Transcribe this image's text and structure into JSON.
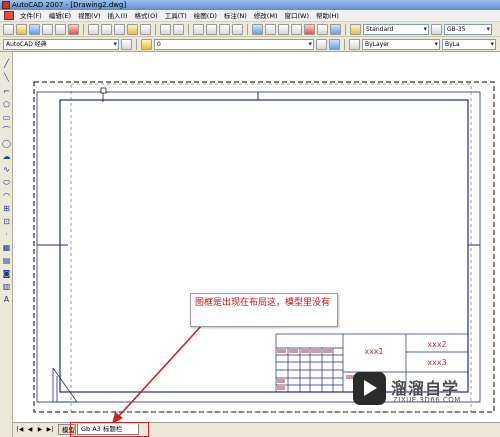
{
  "window": {
    "title": "AutoCAD 2007 - [Drawing2.dwg]"
  },
  "menu": [
    "文件(F)",
    "编辑(E)",
    "视图(V)",
    "插入(I)",
    "格式(O)",
    "工具(T)",
    "绘图(D)",
    "标注(N)",
    "修改(M)",
    "窗口(W)",
    "帮助(H)"
  ],
  "toolbar": {
    "text_style": "Standard",
    "dim_style": "GB-35",
    "workspace": "AutoCAD 经典",
    "layer": "0",
    "color": "ByLayer",
    "linetype": "ByLa"
  },
  "drawing": {
    "title_block": {
      "field_1": "xxx1",
      "field_2": "xxx2",
      "field_3": "xxx3"
    }
  },
  "callout": {
    "text": "图框是出现在布局这，模型里没有"
  },
  "tabs": {
    "model": "模型",
    "layout": "Gb A3 标题栏"
  },
  "watermark": {
    "brand": "溜溜自学",
    "url": "ZIXUE.3D66.COM"
  },
  "icons": [
    "app-icon",
    "new-icon",
    "open-icon",
    "save-icon",
    "print-icon",
    "undo-icon",
    "redo-icon",
    "zoom-icon",
    "layer-icon",
    "line-icon",
    "circle-icon",
    "arc-icon",
    "text-icon"
  ],
  "colors": {
    "frame": "#1e2a8a",
    "callout_text": "#d01010",
    "arrow": "#d02020",
    "highlight": "#e02020"
  }
}
